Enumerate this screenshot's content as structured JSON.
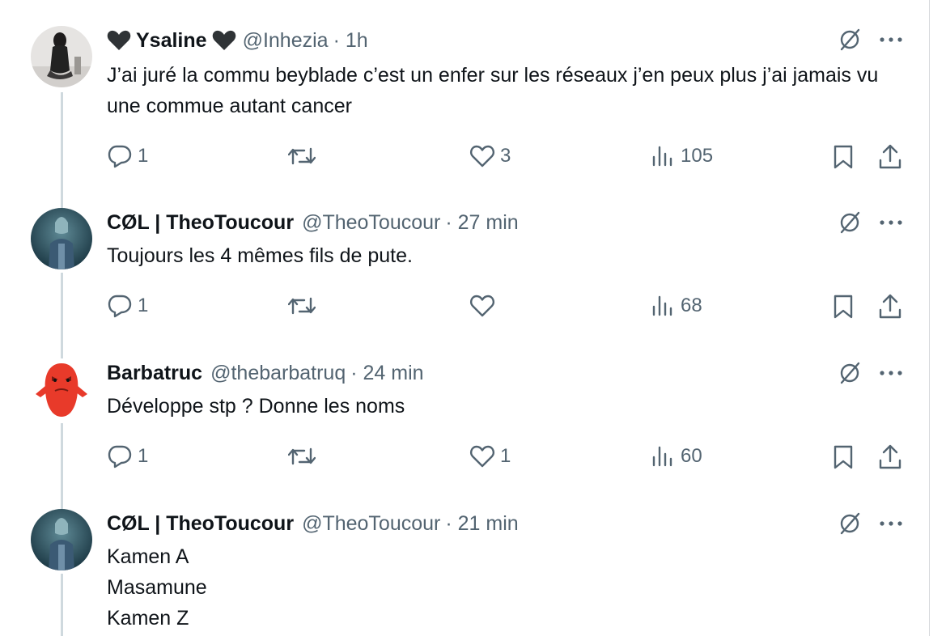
{
  "tweets": [
    {
      "name": "Ysaline",
      "handle": "@Inhezia",
      "time": "· 1h",
      "text": "J’ai juré la commu beyblade c’est un enfer sur les réseaux j’en peux plus j’ai jamais vu une commue autant cancer",
      "replies": "1",
      "retweets": "",
      "likes": "3",
      "views": "105"
    },
    {
      "name": "CØL | TheoToucour",
      "handle": "@TheoToucour",
      "time": "· 27 min",
      "text": "Toujours les 4 mêmes fils de pute.",
      "replies": "1",
      "retweets": "",
      "likes": "",
      "views": "68"
    },
    {
      "name": "Barbatruc",
      "handle": "@thebarbatruq",
      "time": "· 24 min",
      "text": "Développe stp ? Donne les noms",
      "replies": "1",
      "retweets": "",
      "likes": "1",
      "views": "60"
    },
    {
      "name": "CØL | TheoToucour",
      "handle": "@TheoToucour",
      "time": "· 21 min",
      "lines": [
        "Kamen A",
        "Masamune",
        "Kamen Z"
      ]
    }
  ],
  "colors": {
    "text_primary": "#0f1419",
    "text_secondary": "#536471",
    "thread_line": "#cfd9de"
  },
  "icons": [
    "black-heart-icon",
    "grok-icon",
    "more-icon",
    "reply-icon",
    "retweet-icon",
    "like-icon",
    "views-icon",
    "bookmark-icon",
    "share-icon"
  ]
}
